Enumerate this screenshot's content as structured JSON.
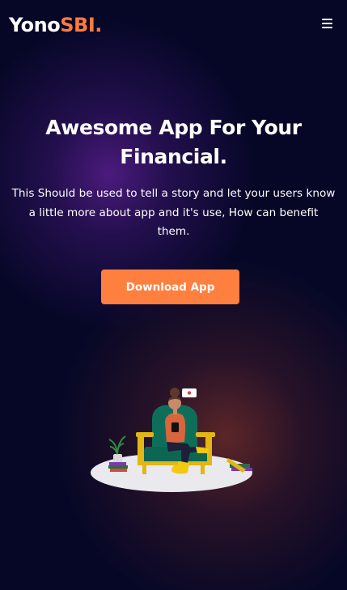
{
  "header": {
    "logo_main": "Yono",
    "logo_accent": "SBI.",
    "menu_icon": "hamburger-menu-icon"
  },
  "hero": {
    "title_line1": "Awesome App For Your",
    "title_line2": "Financial.",
    "description": "This Should be used to tell a story and let your users know a little more about app and it's use, How can benefit them.",
    "download_label": "Download App"
  },
  "illustration": {
    "icon": "person-on-chair-with-phone-illustration"
  },
  "colors": {
    "background": "#060727",
    "accent": "#ff7f3e",
    "glow_purple": "#581e8c",
    "glow_brown": "#783028"
  }
}
